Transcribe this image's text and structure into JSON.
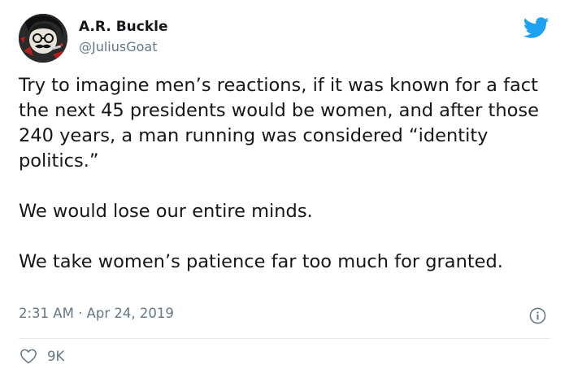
{
  "author": {
    "name": "A.R. Buckle",
    "handle": "@JuliusGoat",
    "avatar_icon": "avatar-icon"
  },
  "brand": {
    "logo_icon": "twitter-bird-icon",
    "color": "#1da1f2"
  },
  "tweet": {
    "paragraphs": [
      "Try to imagine men’s reactions, if it was known for a fact the next 45 presidents would be women, and after those 240 years, a man running was considered “identity politics.”",
      "We would lose our entire minds.",
      "We take women’s patience far too much for granted."
    ],
    "timestamp": "2:31 AM · Apr 24, 2019"
  },
  "engagement": {
    "like_icon": "heart-icon",
    "like_count": "9K"
  },
  "colors": {
    "text": "#14171a",
    "secondary": "#657786",
    "divider": "#e1e8ed"
  }
}
